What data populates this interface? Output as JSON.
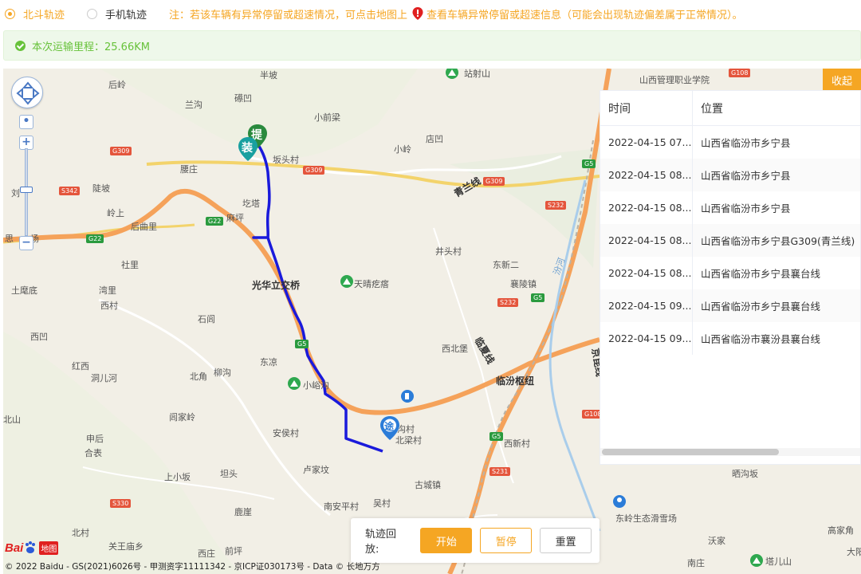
{
  "track_options": [
    {
      "label": "北斗轨迹",
      "selected": true
    },
    {
      "label": "手机轨迹",
      "selected": false
    }
  ],
  "notice": {
    "prefix": "注：若该车辆有异常停留或超速情况，可点击地图上",
    "suffix": "查看车辆异常停留或超速信息（可能会出现轨迹偏差属于正常情况）。"
  },
  "mileage": "本次运输里程：25.66KM",
  "map": {
    "places": [
      "半坡",
      "后岭",
      "兰沟",
      "礤凹",
      "小前梁",
      "腰庄",
      "坂头村",
      "店凹",
      "小岭",
      "刘",
      "陡坡",
      "岭上",
      "后曲里",
      "圪塔",
      "麻坪",
      "思",
      "场",
      "社里",
      "光华立交桥",
      "天晴疙瘩",
      "井头村",
      "东新二",
      "襄陵镇",
      "土麾底",
      "湾里",
      "西村",
      "石闾",
      "西凹",
      "红西",
      "洞儿河",
      "北角",
      "柳沟",
      "东凉",
      "小峪沟",
      "西北堡",
      "临汾枢纽",
      "北山",
      "申后",
      "合表",
      "闾家岭",
      "安侯村",
      "沟村",
      "北梁村",
      "西新村",
      "上小坂",
      "坦头",
      "卢家坟",
      "古城镇",
      "南安平村",
      "吴村",
      "鹿崖",
      "北村",
      "关王庙乡",
      "西庄",
      "前坪",
      "青兰线",
      "临夏线",
      "京昆线",
      "晒沟坂",
      "山西管理职业学院",
      "山西",
      "站射山",
      "沃家",
      "南庄",
      "高家角",
      "大阳",
      "塔儿山",
      "东岭生态滑雪场",
      "汾河"
    ],
    "road_tags": [
      "G309",
      "G309",
      "G309",
      "S342",
      "G22",
      "G22",
      "G5",
      "S232",
      "G5",
      "S232",
      "G5",
      "G108",
      "G5",
      "S231",
      "G108",
      "S330"
    ],
    "marker_pickup": "提",
    "marker_loading": "装",
    "marker_via": "途"
  },
  "table": {
    "collapse": "收起",
    "headers": [
      "时间",
      "位置"
    ],
    "rows": [
      {
        "time": "2022-04-15 07...",
        "location": "山西省临汾市乡宁县"
      },
      {
        "time": "2022-04-15 08...",
        "location": "山西省临汾市乡宁县"
      },
      {
        "time": "2022-04-15 08...",
        "location": "山西省临汾市乡宁县"
      },
      {
        "time": "2022-04-15 08...",
        "location": "山西省临汾市乡宁县G309(青兰线)"
      },
      {
        "time": "2022-04-15 08...",
        "location": "山西省临汾市乡宁县襄台线"
      },
      {
        "time": "2022-04-15 09...",
        "location": "山西省临汾市乡宁县襄台线"
      },
      {
        "time": "2022-04-15 09...",
        "location": "山西省临汾市襄汾县襄台线"
      }
    ]
  },
  "playback": {
    "label": "轨迹回放:",
    "start": "开始",
    "pause": "暂停",
    "reset": "重置"
  },
  "copyright": "© 2022 Baidu - GS(2021)6026号 - 甲测资字11111342 - 京ICP证030173号 - Data © 长地万方",
  "logo": {
    "bai": "Bai",
    "ditu": "地图"
  },
  "colors": {
    "accent": "#f5a623",
    "success": "#67c23a",
    "track": "#1a1adb"
  }
}
